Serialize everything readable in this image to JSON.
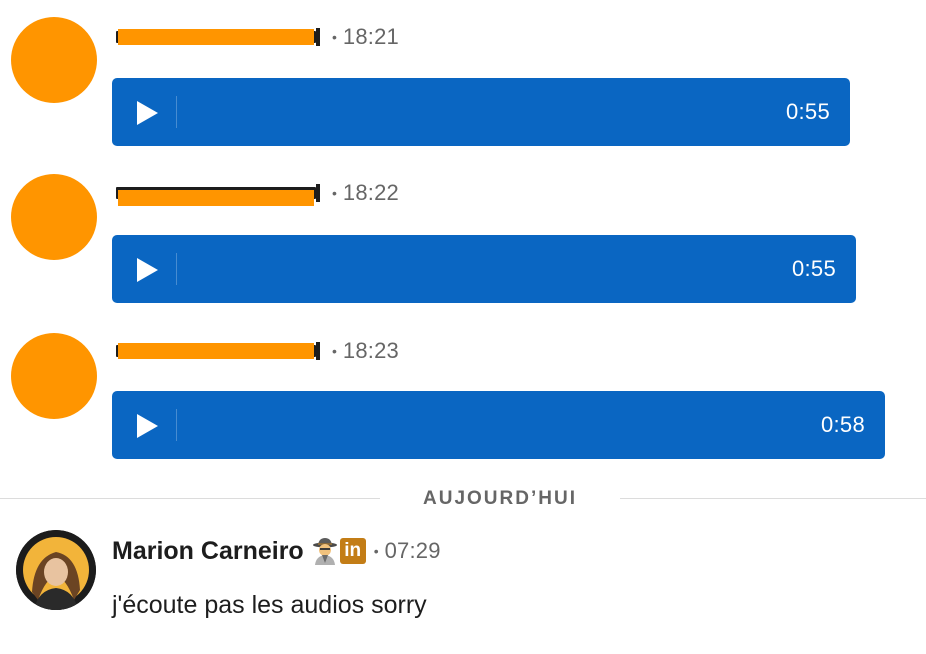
{
  "messages": [
    {
      "sender_redacted": true,
      "time": "18:21",
      "separator": "•",
      "audio": {
        "duration": "0:55"
      }
    },
    {
      "sender_redacted": true,
      "time": "18:22",
      "separator": "•",
      "audio": {
        "duration": "0:55"
      }
    },
    {
      "sender_redacted": true,
      "time": "18:23",
      "separator": "•",
      "audio": {
        "duration": "0:58"
      }
    }
  ],
  "day_divider": {
    "label": "AUJOURD’HUI"
  },
  "reply": {
    "author": "Marion Carneiro",
    "separator": "•",
    "time": "07:29",
    "text": "j'écoute pas les audios sorry",
    "badges": [
      "detective-icon",
      "linkedin-icon"
    ],
    "linkedin_label": "in"
  },
  "colors": {
    "audio_bubble": "#0a66c2",
    "redaction": "#ff9500",
    "linkedin_badge": "#c37d16",
    "divider_line": "#dcdcdc",
    "muted_text": "#666666"
  }
}
